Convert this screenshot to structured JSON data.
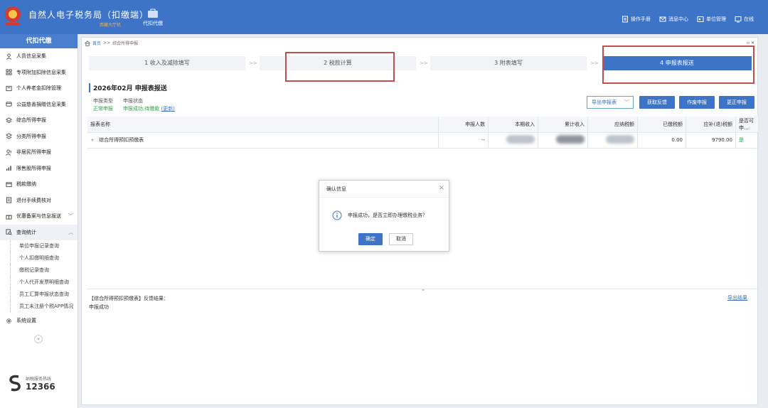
{
  "header": {
    "app_title": "自然人电子税务局（扣缴端）",
    "app_subtitle": "西藏大厅机",
    "module_label": "代扣代缴",
    "links": [
      {
        "icon": "manual-icon",
        "label": "操作手册"
      },
      {
        "icon": "message-icon",
        "label": "消息中心"
      },
      {
        "icon": "unit-icon",
        "label": "单位管理"
      },
      {
        "icon": "online-icon",
        "label": "在线"
      }
    ]
  },
  "sidebar": {
    "title": "代扣代缴",
    "items": [
      {
        "icon": "person-icon",
        "label": "人员信息采集"
      },
      {
        "icon": "grid-icon",
        "label": "专项附加扣除信息采集"
      },
      {
        "icon": "pension-icon",
        "label": "个人养老金扣除管理"
      },
      {
        "icon": "donation-icon",
        "label": "公益慈善捐赠信息采集"
      },
      {
        "icon": "layers-icon",
        "label": "综合所得申报"
      },
      {
        "icon": "category-icon",
        "label": "分类所得申报"
      },
      {
        "icon": "nonresident-icon",
        "label": "非居民所得申报"
      },
      {
        "icon": "chart-icon",
        "label": "限售股所得申报"
      },
      {
        "icon": "wallet-icon",
        "label": "税款缴纳"
      },
      {
        "icon": "refund-icon",
        "label": "退付手续费核对"
      },
      {
        "icon": "gift-icon",
        "label": "优惠备案与信息报送"
      },
      {
        "icon": "query-icon",
        "label": "查询统计"
      },
      {
        "icon": "gear-icon",
        "label": "系统设置"
      }
    ],
    "sub_items": [
      "单位申报记录查询",
      "个人扣缴明细查询",
      "缴税记录查询",
      "个人代开发票明细查询",
      "员工汇算申报状态查询",
      "员工未注册个税APP情况"
    ],
    "hotline_label": "纳税服务热线",
    "hotline_number": "12366"
  },
  "breadcrumb": {
    "home": "首页",
    "sep": ">>",
    "current": "综合所得申报"
  },
  "steps": [
    "1 收入及减除填写",
    "2 税款计算",
    "3 附表填写",
    "4 申报表报送"
  ],
  "step_arrow": ">>",
  "section": {
    "title": "2026年02月  申报表报送",
    "type_label": "申报类型",
    "status_label": "申报状态",
    "type_value": "正常申报",
    "status_value": "申报成功,待缴款",
    "refresh_label": "(更新)"
  },
  "actions": {
    "export_select": "导出申报表",
    "fetch_feedback": "获取反馈",
    "void": "作废申报",
    "correct": "更正申报"
  },
  "table": {
    "headers": [
      "报表名称",
      "申报人数",
      "本期收入",
      "累计收入",
      "应纳税额",
      "已缴税额",
      "应补(退)税额",
      "是否可申..."
    ],
    "row": {
      "expand": "+",
      "name": "综合所得预扣预缴表",
      "count": "--",
      "paid": "0.00",
      "due": "9790.00",
      "can": "是"
    }
  },
  "feedback": {
    "title": "【综合所得预扣预缴表】反馈结果：",
    "text": "申报成功",
    "export_link": "导出结果"
  },
  "modal": {
    "title": "确认信息",
    "message": "申报成功，是否立即办理缴税业务？",
    "ok": "确定",
    "cancel": "取消"
  },
  "colors": {
    "brand": "#3d74c7",
    "highlight": "#c0504d",
    "success": "#27a343"
  }
}
